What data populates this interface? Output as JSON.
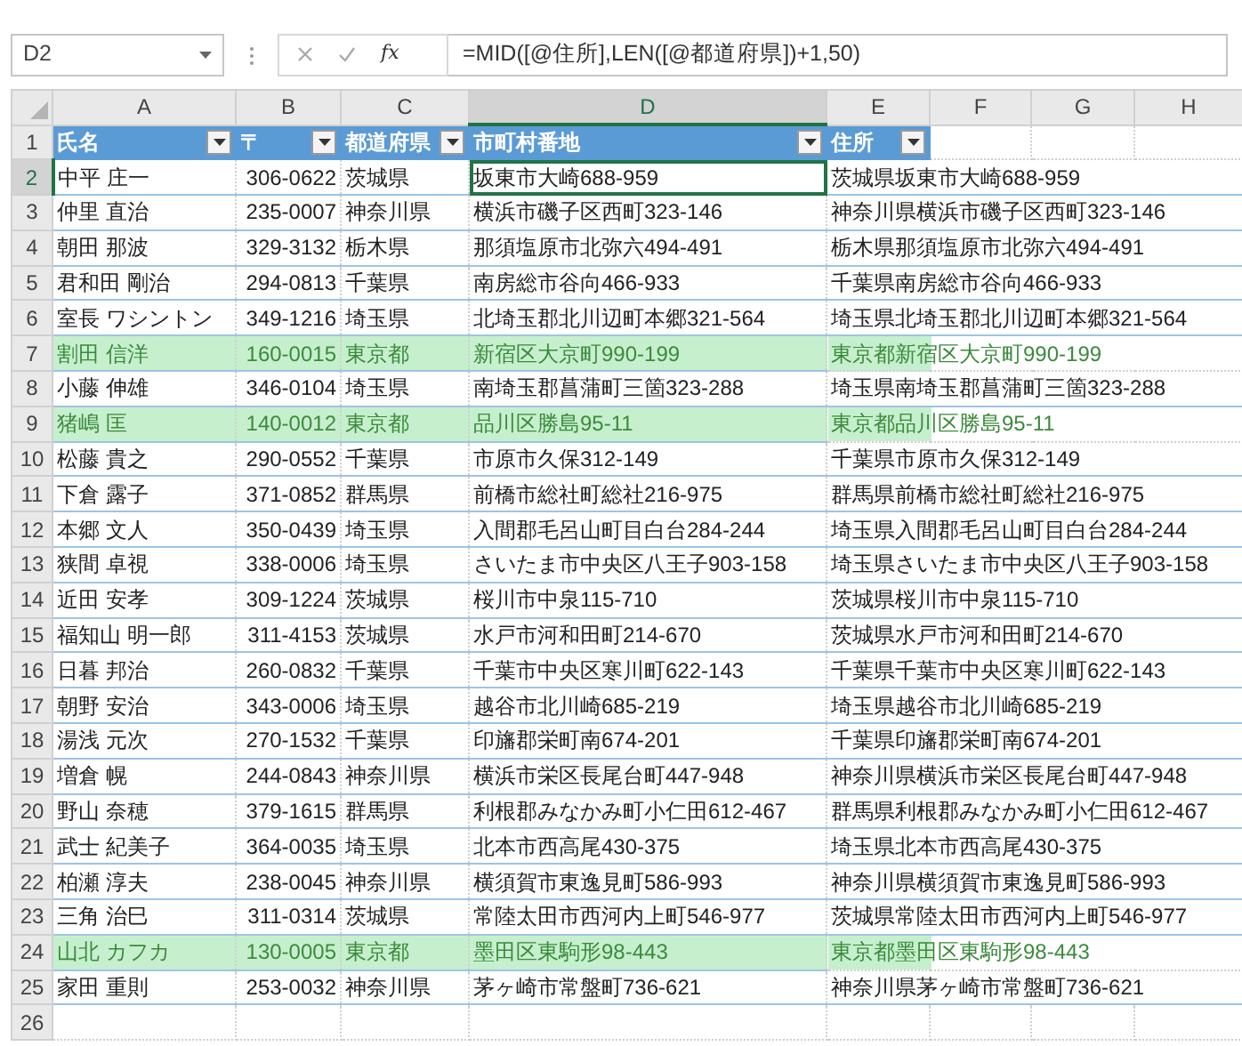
{
  "name_box": "D2",
  "function_label": "fx",
  "formula": "=MID([@住所],LEN([@都道府県])+1,50)",
  "columns": [
    {
      "label": "A",
      "selected": false
    },
    {
      "label": "B",
      "selected": false
    },
    {
      "label": "C",
      "selected": false
    },
    {
      "label": "D",
      "selected": true
    },
    {
      "label": "E",
      "selected": false
    },
    {
      "label": "F",
      "selected": false
    },
    {
      "label": "G",
      "selected": false
    },
    {
      "label": "H",
      "selected": false
    }
  ],
  "header_row": {
    "number": "1",
    "selected": false,
    "headers": [
      "氏名",
      "〒",
      "都道府県",
      "市町村番地",
      "住所"
    ]
  },
  "rows": [
    {
      "number": "2",
      "selected": true,
      "highlighted": false,
      "cells": [
        "中平 庄一",
        "306-0622",
        "茨城県",
        "坂東市大崎688-959",
        "茨城県坂東市大崎688-959"
      ]
    },
    {
      "number": "3",
      "selected": false,
      "highlighted": false,
      "cells": [
        "仲里 直治",
        "235-0007",
        "神奈川県",
        "横浜市磯子区西町323-146",
        "神奈川県横浜市磯子区西町323-146"
      ]
    },
    {
      "number": "4",
      "selected": false,
      "highlighted": false,
      "cells": [
        "朝田 那波",
        "329-3132",
        "栃木県",
        "那須塩原市北弥六494-491",
        "栃木県那須塩原市北弥六494-491"
      ]
    },
    {
      "number": "5",
      "selected": false,
      "highlighted": false,
      "cells": [
        "君和田 剛治",
        "294-0813",
        "千葉県",
        "南房総市谷向466-933",
        "千葉県南房総市谷向466-933"
      ]
    },
    {
      "number": "6",
      "selected": false,
      "highlighted": false,
      "cells": [
        "室長 ワシントン",
        "349-1216",
        "埼玉県",
        "北埼玉郡北川辺町本郷321-564",
        "埼玉県北埼玉郡北川辺町本郷321-564"
      ]
    },
    {
      "number": "7",
      "selected": false,
      "highlighted": true,
      "cells": [
        "割田 信洋",
        "160-0015",
        "東京都",
        "新宿区大京町990-199",
        "東京都新宿区大京町990-199"
      ]
    },
    {
      "number": "8",
      "selected": false,
      "highlighted": false,
      "cells": [
        "小藤 伸雄",
        "346-0104",
        "埼玉県",
        "南埼玉郡菖蒲町三箇323-288",
        "埼玉県南埼玉郡菖蒲町三箇323-288"
      ]
    },
    {
      "number": "9",
      "selected": false,
      "highlighted": true,
      "cells": [
        "猪嶋 匡",
        "140-0012",
        "東京都",
        "品川区勝島95-11",
        "東京都品川区勝島95-11"
      ]
    },
    {
      "number": "10",
      "selected": false,
      "highlighted": false,
      "cells": [
        "松藤 貴之",
        "290-0552",
        "千葉県",
        "市原市久保312-149",
        "千葉県市原市久保312-149"
      ]
    },
    {
      "number": "11",
      "selected": false,
      "highlighted": false,
      "cells": [
        "下倉 露子",
        "371-0852",
        "群馬県",
        "前橋市総社町総社216-975",
        "群馬県前橋市総社町総社216-975"
      ]
    },
    {
      "number": "12",
      "selected": false,
      "highlighted": false,
      "cells": [
        "本郷 文人",
        "350-0439",
        "埼玉県",
        "入間郡毛呂山町目白台284-244",
        "埼玉県入間郡毛呂山町目白台284-244"
      ]
    },
    {
      "number": "13",
      "selected": false,
      "highlighted": false,
      "cells": [
        "狭間 卓視",
        "338-0006",
        "埼玉県",
        "さいたま市中央区八王子903-158",
        "埼玉県さいたま市中央区八王子903-158"
      ]
    },
    {
      "number": "14",
      "selected": false,
      "highlighted": false,
      "cells": [
        "近田 安孝",
        "309-1224",
        "茨城県",
        "桜川市中泉115-710",
        "茨城県桜川市中泉115-710"
      ]
    },
    {
      "number": "15",
      "selected": false,
      "highlighted": false,
      "cells": [
        "福知山 明一郎",
        "311-4153",
        "茨城県",
        "水戸市河和田町214-670",
        "茨城県水戸市河和田町214-670"
      ]
    },
    {
      "number": "16",
      "selected": false,
      "highlighted": false,
      "cells": [
        "日暮 邦治",
        "260-0832",
        "千葉県",
        "千葉市中央区寒川町622-143",
        "千葉県千葉市中央区寒川町622-143"
      ]
    },
    {
      "number": "17",
      "selected": false,
      "highlighted": false,
      "cells": [
        "朝野 安治",
        "343-0006",
        "埼玉県",
        "越谷市北川崎685-219",
        "埼玉県越谷市北川崎685-219"
      ]
    },
    {
      "number": "18",
      "selected": false,
      "highlighted": false,
      "cells": [
        "湯浅 元次",
        "270-1532",
        "千葉県",
        "印旛郡栄町南674-201",
        "千葉県印旛郡栄町南674-201"
      ]
    },
    {
      "number": "19",
      "selected": false,
      "highlighted": false,
      "cells": [
        "増倉 幌",
        "244-0843",
        "神奈川県",
        "横浜市栄区長尾台町447-948",
        "神奈川県横浜市栄区長尾台町447-948"
      ]
    },
    {
      "number": "20",
      "selected": false,
      "highlighted": false,
      "cells": [
        "野山 奈穂",
        "379-1615",
        "群馬県",
        "利根郡みなかみ町小仁田612-467",
        "群馬県利根郡みなかみ町小仁田612-467"
      ]
    },
    {
      "number": "21",
      "selected": false,
      "highlighted": false,
      "cells": [
        "武士 紀美子",
        "364-0035",
        "埼玉県",
        "北本市西高尾430-375",
        "埼玉県北本市西高尾430-375"
      ]
    },
    {
      "number": "22",
      "selected": false,
      "highlighted": false,
      "cells": [
        "柏瀬 淳夫",
        "238-0045",
        "神奈川県",
        "横須賀市東逸見町586-993",
        "神奈川県横須賀市東逸見町586-993"
      ]
    },
    {
      "number": "23",
      "selected": false,
      "highlighted": false,
      "cells": [
        "三角 治巳",
        "311-0314",
        "茨城県",
        "常陸太田市西河内上町546-977",
        "茨城県常陸太田市西河内上町546-977"
      ]
    },
    {
      "number": "24",
      "selected": false,
      "highlighted": true,
      "cells": [
        "山北 カフカ",
        "130-0005",
        "東京都",
        "墨田区東駒形98-443",
        "東京都墨田区東駒形98-443"
      ]
    },
    {
      "number": "25",
      "selected": false,
      "highlighted": false,
      "cells": [
        "家田 重則",
        "253-0032",
        "神奈川県",
        "茅ヶ崎市常盤町736-621",
        "神奈川県茅ヶ崎市常盤町736-621"
      ]
    }
  ],
  "empty_rows": [
    {
      "number": "26",
      "selected": false
    }
  ]
}
